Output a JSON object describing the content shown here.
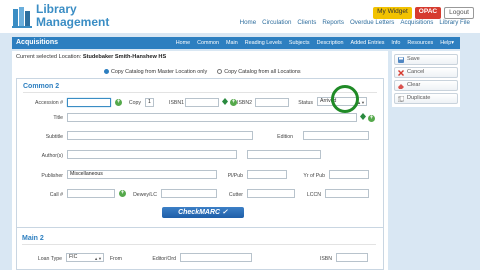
{
  "app": {
    "logo_line1": "Library",
    "logo_line2": "Management"
  },
  "top_links": {
    "widget": "My Widget",
    "opac": "OPAC",
    "logout": "Logout"
  },
  "main_nav": [
    "Home",
    "Circulation",
    "Clients",
    "Reports",
    "Overdue Letters",
    "Acquisitions",
    "Library File"
  ],
  "acquisitions": {
    "title": "Acquisitions",
    "nav": [
      "Home",
      "Common",
      "Main",
      "Reading Levels",
      "Subjects",
      "Description",
      "Added Entries",
      "Info",
      "Resources",
      "Help"
    ],
    "help_caret": "▾"
  },
  "location": {
    "label": "Current selected Location:",
    "value": "Studebaker Smith-Hanshew HS"
  },
  "copy_options": {
    "master": "Copy Catalog from Master Location only",
    "all": "Copy Catalog from all Locations"
  },
  "common": {
    "title": "Common 2",
    "accession_label": "Accession #",
    "accession_value": "",
    "copy_label": "Copy",
    "copy_value": "1",
    "isbn1_label": "ISBN1",
    "isbn2_label": "ISBN2",
    "status_label": "Status",
    "status_value": "Arrived",
    "title_label": "Title",
    "subtitle_label": "Subtitle",
    "edition_label": "Edition",
    "authors_label": "Author(s)",
    "publisher_label": "Publisher",
    "publisher_value": "Miscellaneous",
    "plpub_label": "Pl/Pub",
    "yrpub_label": "Yr of Pub",
    "call_label": "Call #",
    "dewey_label": "Dewey/LC",
    "cutter_label": "Cutter",
    "lccn_label": "LCCN",
    "checkmarc": "CheckMARC"
  },
  "main2": {
    "title": "Main 2",
    "loan_type_label": "Loan Type",
    "loan_type_value": "FIC",
    "from_label": "From",
    "editor_label": "Editor/Ord",
    "isbn_label": "ISBN"
  },
  "actions": {
    "save": "Save",
    "cancel": "Cancel",
    "clear": "Clear",
    "duplicate": "Duplicate"
  },
  "colors": {
    "brand_blue": "#2d7fc0",
    "band_blue": "#d9e7f3",
    "widget_yellow": "#f2c200",
    "opac_red": "#d63b2f",
    "annotation_green": "#1f8a26",
    "plus_green": "#55a94b"
  },
  "icons": {
    "logo": "book-stack-icon",
    "save": "disk-icon",
    "cancel": "x-icon",
    "clear": "eraser-icon",
    "duplicate": "copy-icon",
    "isbn_lookup": "diamond-arrow-icon",
    "add": "green-plus-icon"
  }
}
